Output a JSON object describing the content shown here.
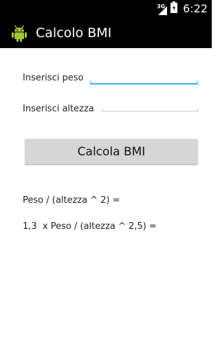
{
  "status_bar": {
    "network_label": "3G",
    "time": "6:22",
    "icons": [
      "signal-icon",
      "battery-icon"
    ]
  },
  "action_bar": {
    "icon": "android-icon",
    "title": "Calcolo BMI"
  },
  "form": {
    "weight_label": "Inserisci peso",
    "weight_value": "",
    "height_label": "Inserisci altezza",
    "height_value": ""
  },
  "button": {
    "label": "Calcola BMI"
  },
  "results": {
    "formula1": "Peso / (altezza ^ 2) =",
    "formula2": "1,3  x Peso / (altezza ^ 2,5) ="
  },
  "colors": {
    "focus_accent": "#33b5e5",
    "android_green": "#a4c639"
  }
}
